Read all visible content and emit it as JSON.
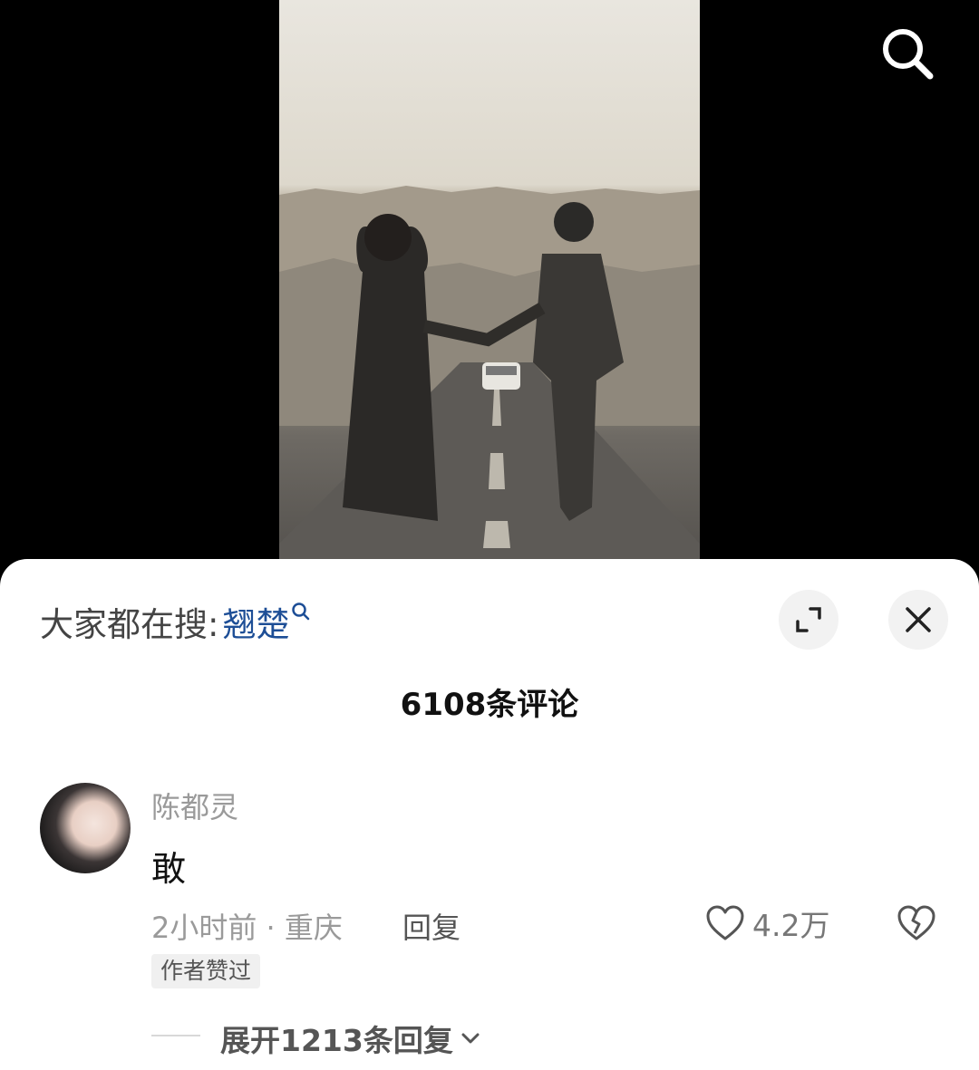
{
  "trending": {
    "prefix": "大家都在搜:",
    "keyword": "翘楚"
  },
  "comments_header": {
    "count_text": "6108条评论"
  },
  "comment": {
    "username": "陈都灵",
    "text": "敢",
    "meta": "2小时前 · 重庆",
    "reply_label": "回复",
    "like_count": "4.2万",
    "badge": "作者赞过",
    "expand_label": "展开1213条回复"
  },
  "colors": {
    "keyword": "#1d4e96",
    "muted": "#9a9a9a",
    "sheet_bg": "#ffffff"
  },
  "icons": [
    "search-icon",
    "expand-icon",
    "close-icon",
    "heart-icon",
    "broken-heart-icon",
    "chevron-down-icon"
  ]
}
